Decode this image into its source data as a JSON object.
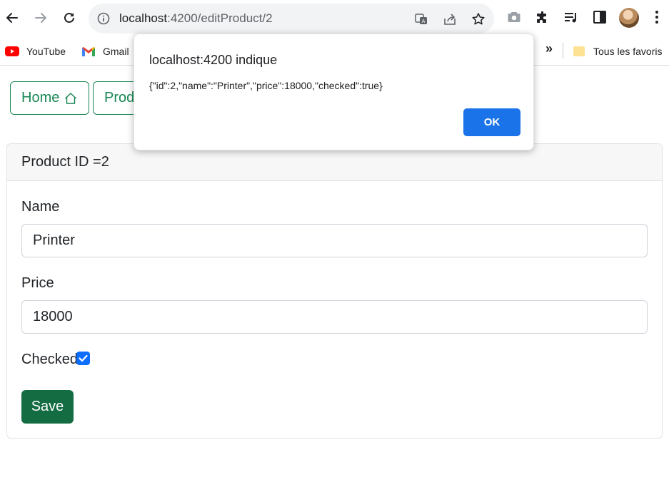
{
  "browser": {
    "url_host": "localhost",
    "url_path": ":4200/editProduct/2",
    "bookmarks": [
      {
        "label": "YouTube",
        "icon": "youtube-icon"
      },
      {
        "label": "Gmail",
        "icon": "gmail-icon"
      }
    ],
    "more_bookmarks": "»",
    "all_bookmarks_label": "Tous les favoris"
  },
  "nav": {
    "home_label": "Home",
    "products_label": "Prod"
  },
  "card": {
    "header": "Product ID =2",
    "name_label": "Name",
    "name_value": "Printer",
    "price_label": "Price",
    "price_value": "18000",
    "checked_label": "Checked",
    "checked": true,
    "save_label": "Save"
  },
  "dialog": {
    "title": "localhost:4200 indique",
    "message": "{\"id\":2,\"name\":\"Printer\",\"price\":18000,\"checked\":true}",
    "ok_label": "OK"
  },
  "colors": {
    "success": "#198754",
    "save_button": "#146c43",
    "checkbox": "#0d6efd",
    "dialog_ok": "#1a73e8"
  }
}
